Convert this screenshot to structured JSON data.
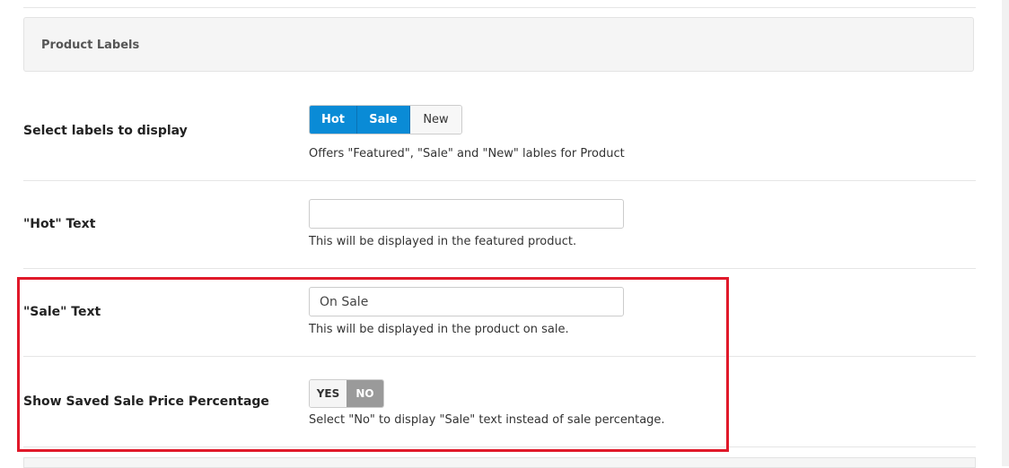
{
  "section": {
    "title": "Product Labels"
  },
  "labels_row": {
    "label": "Select labels to display",
    "options": [
      {
        "label": "Hot",
        "active": true
      },
      {
        "label": "Sale",
        "active": true
      },
      {
        "label": "New",
        "active": false
      }
    ],
    "description": "Offers \"Featured\", \"Sale\" and \"New\" lables for Product"
  },
  "hot_row": {
    "label": "\"Hot\" Text",
    "value": "",
    "description": "This will be displayed in the featured product."
  },
  "sale_row": {
    "label": "\"Sale\" Text",
    "value": "On Sale",
    "description": "This will be displayed in the product on sale."
  },
  "percentage_row": {
    "label": "Show Saved Sale Price Percentage",
    "yes_label": "YES",
    "no_label": "NO",
    "selected": "NO",
    "description": "Select \"No\" to display \"Sale\" text instead of sale percentage."
  },
  "colors": {
    "accent": "#0a8bd6",
    "highlight": "#e0192a",
    "toggle_selected": "#9a9a9a"
  }
}
